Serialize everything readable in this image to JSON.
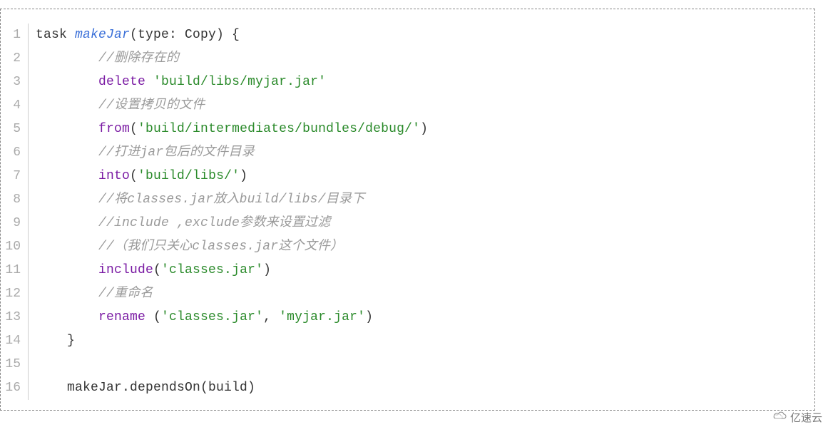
{
  "code": {
    "lines": [
      {
        "n": "1",
        "indent": 0,
        "segments": [
          {
            "cls": "plain",
            "t": "task "
          },
          {
            "cls": "fn",
            "t": "makeJar"
          },
          {
            "cls": "plain",
            "t": "(type: Copy) {"
          }
        ]
      },
      {
        "n": "2",
        "indent": 2,
        "segments": [
          {
            "cls": "comment",
            "t": "//删除存在的"
          }
        ]
      },
      {
        "n": "3",
        "indent": 2,
        "segments": [
          {
            "cls": "kw",
            "t": "delete"
          },
          {
            "cls": "plain",
            "t": " "
          },
          {
            "cls": "str",
            "t": "'build/libs/myjar.jar'"
          }
        ]
      },
      {
        "n": "4",
        "indent": 2,
        "segments": [
          {
            "cls": "comment",
            "t": "//设置拷贝的文件"
          }
        ]
      },
      {
        "n": "5",
        "indent": 2,
        "segments": [
          {
            "cls": "kw",
            "t": "from"
          },
          {
            "cls": "plain",
            "t": "("
          },
          {
            "cls": "str",
            "t": "'build/intermediates/bundles/debug/'"
          },
          {
            "cls": "plain",
            "t": ")"
          }
        ]
      },
      {
        "n": "6",
        "indent": 2,
        "segments": [
          {
            "cls": "comment",
            "t": "//打进jar包后的文件目录"
          }
        ]
      },
      {
        "n": "7",
        "indent": 2,
        "segments": [
          {
            "cls": "kw",
            "t": "into"
          },
          {
            "cls": "plain",
            "t": "("
          },
          {
            "cls": "str",
            "t": "'build/libs/'"
          },
          {
            "cls": "plain",
            "t": ")"
          }
        ]
      },
      {
        "n": "8",
        "indent": 2,
        "segments": [
          {
            "cls": "comment",
            "t": "//将classes.jar放入build/libs/目录下"
          }
        ]
      },
      {
        "n": "9",
        "indent": 2,
        "segments": [
          {
            "cls": "comment",
            "t": "//include ,exclude参数来设置过滤"
          }
        ]
      },
      {
        "n": "10",
        "indent": 2,
        "segments": [
          {
            "cls": "comment",
            "t": "//（我们只关心classes.jar这个文件）"
          }
        ]
      },
      {
        "n": "11",
        "indent": 2,
        "segments": [
          {
            "cls": "kw",
            "t": "include"
          },
          {
            "cls": "plain",
            "t": "("
          },
          {
            "cls": "str",
            "t": "'classes.jar'"
          },
          {
            "cls": "plain",
            "t": ")"
          }
        ]
      },
      {
        "n": "12",
        "indent": 2,
        "segments": [
          {
            "cls": "comment",
            "t": "//重命名"
          }
        ]
      },
      {
        "n": "13",
        "indent": 2,
        "segments": [
          {
            "cls": "kw",
            "t": "rename"
          },
          {
            "cls": "plain",
            "t": " ("
          },
          {
            "cls": "str",
            "t": "'classes.jar'"
          },
          {
            "cls": "plain",
            "t": ", "
          },
          {
            "cls": "str",
            "t": "'myjar.jar'"
          },
          {
            "cls": "plain",
            "t": ")"
          }
        ]
      },
      {
        "n": "14",
        "indent": 1,
        "segments": [
          {
            "cls": "plain",
            "t": "}"
          }
        ]
      },
      {
        "n": "15",
        "indent": 0,
        "segments": []
      },
      {
        "n": "16",
        "indent": 1,
        "segments": [
          {
            "cls": "plain",
            "t": "makeJar.dependsOn(build)"
          }
        ]
      }
    ],
    "indent_unit": "    "
  },
  "watermark": "亿速云"
}
